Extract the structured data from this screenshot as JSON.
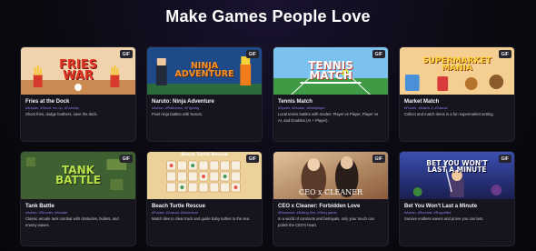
{
  "page": {
    "title": "Make Games People Love"
  },
  "badge_label": "GIF",
  "colors": {
    "accent": "#8f7ff0",
    "card_bg": "#16151d",
    "page_bg": "#0b0a12"
  },
  "cards": [
    {
      "title": "Fries at the Dock",
      "tags": "#Arcade, #Shoot 'em up, #Comedy",
      "desc": "Shoot fries, dodge feathers, save the dock.",
      "thumb_text": "FRIES WAR",
      "thumb_icon": "fries-war-art"
    },
    {
      "title": "Naruto: Ninja Adventure",
      "tags": "#Action, #Platformer, #Fighting",
      "desc": "Pixel ninja battles with Naruto.",
      "thumb_text": "NINJA ADVENTURE",
      "thumb_icon": "ninja-adventure-art"
    },
    {
      "title": "Tennis Match",
      "tags": "#Sports, #Arcade, #Multiplayer",
      "desc": "Local tennis battles with modes: Player vs Player, Player vs AI, and Doubles (AI + Player).",
      "thumb_text": "TENNIS MATCH",
      "thumb_icon": "tennis-match-art"
    },
    {
      "title": "Market Match",
      "tags": "#Puzzle, #Match-3, #Casual",
      "desc": "Collect and match items in a fun supermarket setting.",
      "thumb_text": "SUPERMARKET MANIA",
      "thumb_icon": "market-mania-art"
    },
    {
      "title": "Tank Battle",
      "tags": "#Action, #Shooter, #Arcade",
      "desc": "Classic arcade tank combat with obstacles, bullets, and enemy waves.",
      "thumb_text": "TANK BATTLE",
      "thumb_icon": "tank-battle-art"
    },
    {
      "title": "Beach Turtle Rescue",
      "tags": "#Puzzle, #Casual, #Adventure",
      "desc": "Match tiles to clear track and guide baby turtles to the sea.",
      "thumb_text": "Beach Turtle Rescue",
      "thumb_icon": "turtle-tiles-art"
    },
    {
      "title": "CEO x Cleaner: Forbidden Love",
      "tags": "#Romance, #Dating Sim, #Story game",
      "desc": "In a world of contracts and betrayals, only your touch can polish the CEO's heart.",
      "thumb_text": "CEO x CLEANER",
      "thumb_icon": "ceo-cleaner-art"
    },
    {
      "title": "Bet You Won't Last a Minute",
      "tags": "#Action, #Survival, #Roguelike",
      "desc": "Survive endless waves and prove you can last.",
      "thumb_text": "BET YOU WON'T LAST A MINUTE",
      "thumb_icon": "last-minute-art"
    }
  ]
}
